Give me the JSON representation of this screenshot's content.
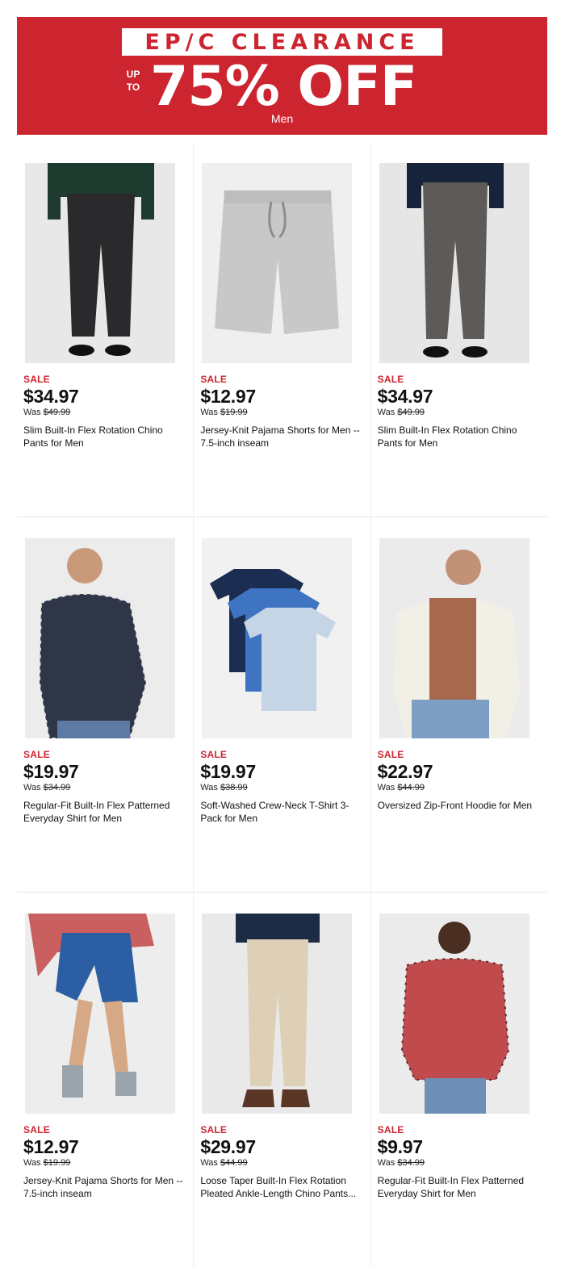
{
  "banner": {
    "headline": "EP/C CLEARANCE",
    "up_to": "UP TO",
    "discount": "75% OFF",
    "department": "Men",
    "color": "#cc2530"
  },
  "products": [
    {
      "badge": "SALE",
      "price": "$34.97",
      "was_label": "Was",
      "was_price": "$49.99",
      "name": "Slim Built-In Flex Rotation Chino Pants for Men",
      "image": "dark-chino-pants"
    },
    {
      "badge": "SALE",
      "price": "$12.97",
      "was_label": "Was",
      "was_price": "$19.99",
      "name": "Jersey-Knit Pajama Shorts for Men -- 7.5-inch inseam",
      "image": "gray-pajama-shorts"
    },
    {
      "badge": "SALE",
      "price": "$34.97",
      "was_label": "Was",
      "was_price": "$49.99",
      "name": "Slim Built-In Flex Rotation Chino Pants for Men",
      "image": "plaid-chino-pants"
    },
    {
      "badge": "SALE",
      "price": "$19.97",
      "was_label": "Was",
      "was_price": "$34.99",
      "name": "Regular-Fit Built-In Flex Patterned Everyday Shirt for Men",
      "image": "gingham-shirt"
    },
    {
      "badge": "SALE",
      "price": "$19.97",
      "was_label": "Was",
      "was_price": "$38.99",
      "name": "Soft-Washed Crew-Neck T-Shirt 3-Pack for Men",
      "image": "tshirt-3-pack"
    },
    {
      "badge": "SALE",
      "price": "$22.97",
      "was_label": "Was",
      "was_price": "$44.99",
      "name": "Oversized Zip-Front Hoodie for Men",
      "image": "cream-hoodie"
    },
    {
      "badge": "SALE",
      "price": "$12.97",
      "was_label": "Was",
      "was_price": "$19.99",
      "name": "Jersey-Knit Pajama Shorts for Men -- 7.5-inch inseam",
      "image": "blue-shorts"
    },
    {
      "badge": "SALE",
      "price": "$29.97",
      "was_label": "Was",
      "was_price": "$44.99",
      "name": "Loose Taper Built-In Flex Rotation Pleated Ankle-Length Chino Pants...",
      "image": "khaki-chino-pants"
    },
    {
      "badge": "SALE",
      "price": "$9.97",
      "was_label": "Was",
      "was_price": "$34.99",
      "name": "Regular-Fit Built-In Flex Patterned Everyday Shirt for Men",
      "image": "red-plaid-shirt"
    }
  ]
}
